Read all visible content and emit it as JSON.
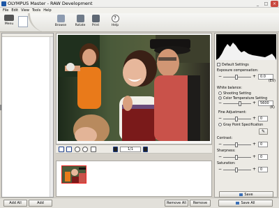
{
  "window": {
    "title": "OLYMPUS Master - RAW Development",
    "minimize": "_",
    "maximize": "□",
    "close": "×"
  },
  "menu": [
    "File",
    "Edit",
    "View",
    "Tools",
    "Help"
  ],
  "toolbar": {
    "menu": "Menu",
    "browse": "Browse",
    "rotate": "Rotate",
    "print": "Print",
    "help": "Help"
  },
  "left_panel": {
    "add_all": "Add All",
    "add": "Add"
  },
  "preview": {
    "page": "1/1"
  },
  "filmstrip": {
    "remove_all": "Remove All",
    "remove": "Remove"
  },
  "adjust": {
    "default_settings": "Default Settings",
    "exposure_label": "Exposure compensation:",
    "exposure_value": "0.0",
    "exposure_unit": "(EV)",
    "white_balance_label": "White balance:",
    "shooting_setting": "Shooting Setting",
    "color_temp_setting": "Color Temperature Setting",
    "color_temp_value": "5600",
    "color_temp_unit": "(K)",
    "fine_adjustment_label": "Fine Adjustment:",
    "fine_adjustment_value": "0",
    "gray_point": "Gray Point Specification",
    "contrast_label": "Contrast:",
    "contrast_value": "0",
    "sharpness_label": "Sharpness:",
    "sharpness_value": "0",
    "saturation_label": "Saturation:",
    "saturation_value": "0",
    "save": "Save",
    "save_all": "Save All"
  },
  "colors": {
    "accent": "#1d57a6",
    "panel": "#eceae4",
    "close": "#c9483f"
  }
}
